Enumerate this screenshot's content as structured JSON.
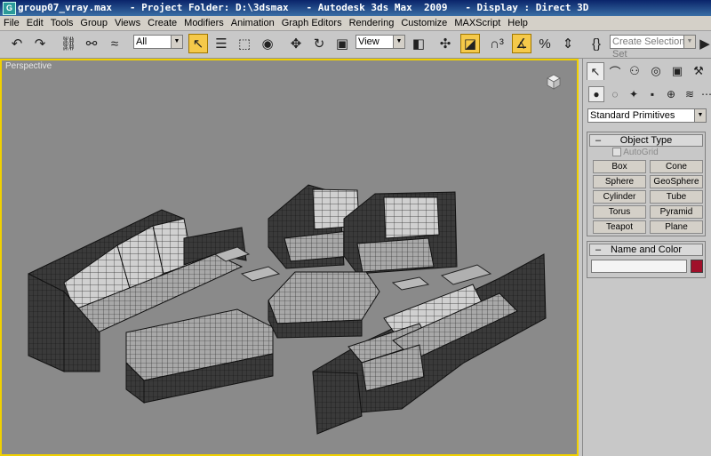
{
  "window": {
    "title": "group07_vray.max   - Project Folder: D:\\3dsmax   - Autodesk 3ds Max  2009   - Display : Direct 3D",
    "app_icon": "G"
  },
  "menu": [
    "File",
    "Edit",
    "Tools",
    "Group",
    "Views",
    "Create",
    "Modifiers",
    "Animation",
    "Graph Editors",
    "Rendering",
    "Customize",
    "MAXScript",
    "Help"
  ],
  "toolbar": {
    "filter_value": "All",
    "refcoord_value": "View",
    "selection_set_placeholder": "Create Selection Set",
    "icons": [
      "undo-icon",
      "redo-icon",
      "link-icon",
      "unlink-icon",
      "bind-spacewarp-icon",
      "select-object-icon",
      "select-by-name-icon",
      "rect-region-icon",
      "window-crossing-icon",
      "move-icon",
      "rotate-icon",
      "scale-icon",
      "pivot-icon",
      "manipulate-icon",
      "keyboard-shortcut-icon",
      "snap-icon",
      "angle-snap-icon",
      "percent-snap-icon",
      "spinner-snap-icon",
      "named-selection-icon",
      "mirror-icon"
    ]
  },
  "viewport": {
    "label": "Perspective"
  },
  "command_panel": {
    "dropdown_value": "Standard Primitives",
    "object_type": {
      "title": "Object Type",
      "autogrid_label": "AutoGrid",
      "buttons": [
        "Box",
        "Cone",
        "Sphere",
        "GeoSphere",
        "Cylinder",
        "Tube",
        "Torus",
        "Pyramid",
        "Teapot",
        "Plane"
      ]
    },
    "name_color": {
      "title": "Name and Color",
      "name_value": "",
      "color": "#a0102a"
    }
  },
  "colors": {
    "viewport_bg": "#8a8a8a",
    "active_border": "#f0d000",
    "panel_bg": "#c8c8c8",
    "highlight": "#f5c94a"
  }
}
